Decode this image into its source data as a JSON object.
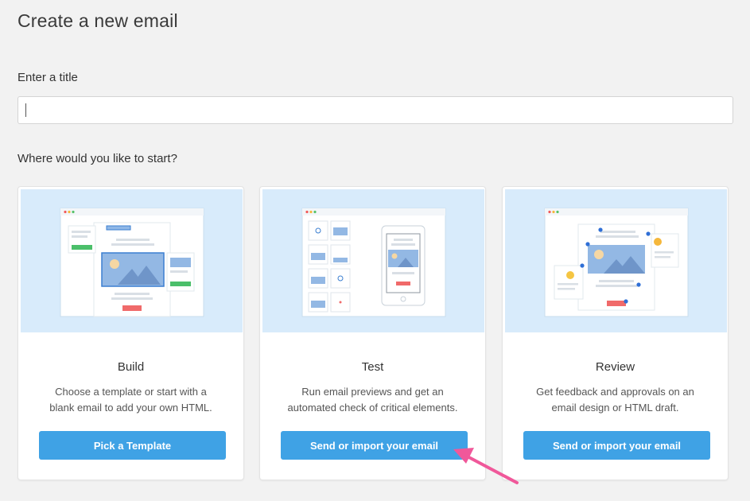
{
  "page": {
    "title": "Create a new email"
  },
  "form": {
    "title_label": "Enter a title",
    "title_value": "",
    "start_label": "Where would you like to start?"
  },
  "cards": [
    {
      "title": "Build",
      "desc_line1": "Choose a template or start with a",
      "desc_line2": "blank email to add your own HTML.",
      "button": "Pick a Template",
      "illustration": "build-illustration"
    },
    {
      "title": "Test",
      "desc_line1": "Run email previews and get an",
      "desc_line2": "automated check of critical elements.",
      "button": "Send or import your email",
      "illustration": "test-illustration"
    },
    {
      "title": "Review",
      "desc_line1": "Get feedback and approvals on an",
      "desc_line2": "email design or HTML draft.",
      "button": "Send or import your email",
      "illustration": "review-illustration"
    }
  ],
  "colors": {
    "accent": "#3fa2e5",
    "illustration_bg": "#d8ebfb",
    "arrow": "#f0589a"
  },
  "annotation": {
    "icon": "pointer-arrow-icon"
  }
}
